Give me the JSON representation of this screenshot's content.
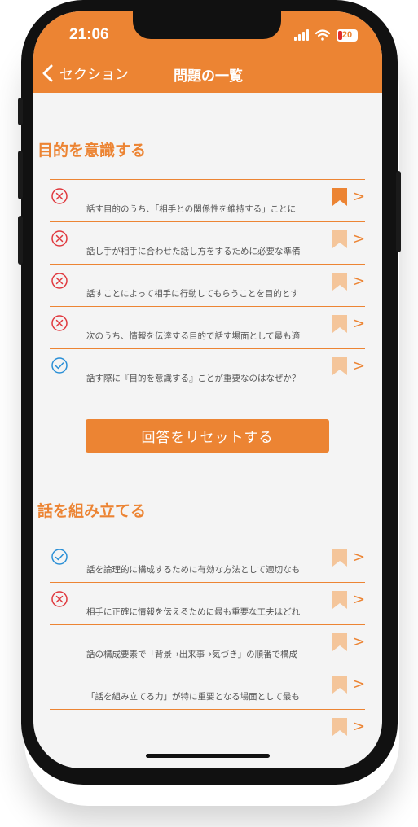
{
  "status_bar": {
    "time": "21:06",
    "battery": "20"
  },
  "nav": {
    "back_label": "セクション",
    "title": "問題の一覧"
  },
  "sections": [
    {
      "title": "目的を意識する",
      "questions": [
        {
          "status": "wrong",
          "text": "話す目的のうち、「相手との関係性を維持する」ことに",
          "bookmarked": true
        },
        {
          "status": "wrong",
          "text": "話し手が相手に合わせた話し方をするために必要な準備",
          "bookmarked": false
        },
        {
          "status": "wrong",
          "text": "話すことによって相手に行動してもらうことを目的とす",
          "bookmarked": false
        },
        {
          "status": "wrong",
          "text": "次のうち、情報を伝達する目的で話す場面として最も適",
          "bookmarked": false
        },
        {
          "status": "correct",
          "text": "話す際に『目的を意識する』ことが重要なのはなぜか？",
          "bookmarked": false
        }
      ],
      "reset_label": "回答をリセットする"
    },
    {
      "title": "話を組み立てる",
      "questions": [
        {
          "status": "correct",
          "text": "話を論理的に構成するために有効な方法として適切なも",
          "bookmarked": false
        },
        {
          "status": "wrong",
          "text": "相手に正確に情報を伝えるために最も重要な工夫はどれ",
          "bookmarked": false
        },
        {
          "status": "none",
          "text": "話の構成要素で「背景→出来事→気づき」の順番で構成",
          "bookmarked": false
        },
        {
          "status": "none",
          "text": "「話を組み立てる力」が特に重要となる場面として最も",
          "bookmarked": false
        },
        {
          "status": "none",
          "text": "",
          "bookmarked": false
        }
      ]
    }
  ],
  "colors": {
    "accent": "#ec8433",
    "wrong": "#e0393e",
    "correct": "#2a8fd6",
    "bookmark_on": "#ec8433",
    "bookmark_off": "#f4c59a"
  }
}
